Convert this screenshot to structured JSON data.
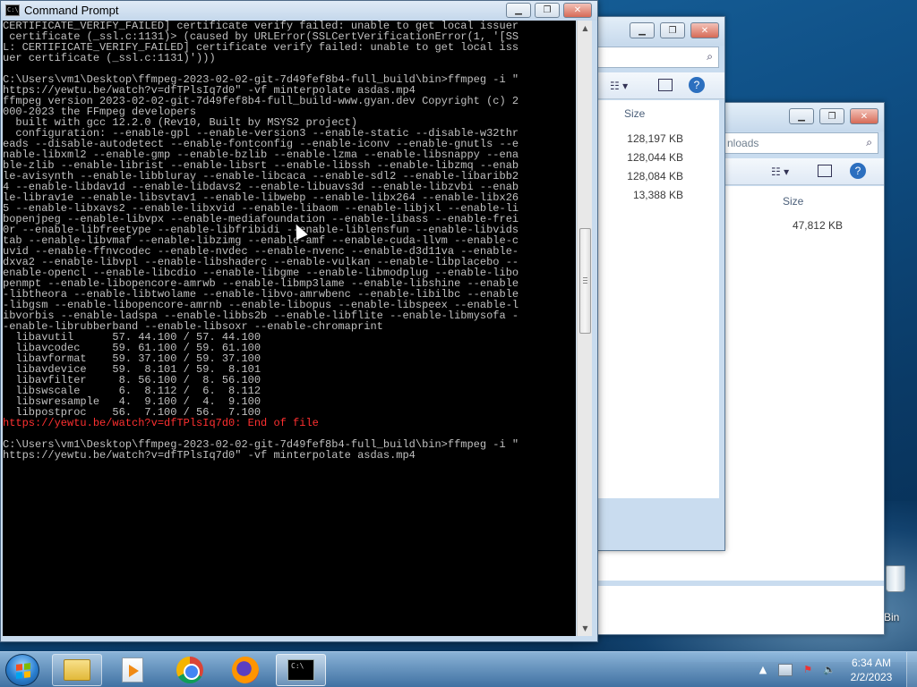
{
  "desktop": {
    "recycle_bin_label": "Bin"
  },
  "explorer_back": {
    "column_size": "Size",
    "sizes": [
      "128,197 KB",
      "128,044 KB",
      "128,084 KB",
      "13,388 KB"
    ]
  },
  "explorer_front": {
    "search_placeholder": "nloads",
    "column_size": "Size",
    "sizes": [
      "47,812 KB"
    ]
  },
  "cmd": {
    "title": "Command Prompt",
    "icon_text": "C:\\",
    "lines": [
      "CERTIFICATE_VERIFY_FAILED] certificate verify failed: unable to get local issuer",
      " certificate (_ssl.c:1131)> (caused by URLError(SSLCertVerificationError(1, '[SS",
      "L: CERTIFICATE_VERIFY_FAILED] certificate verify failed: unable to get local iss",
      "uer certificate (_ssl.c:1131)')))",
      "",
      "C:\\Users\\vm1\\Desktop\\ffmpeg-2023-02-02-git-7d49fef8b4-full_build\\bin>ffmpeg -i \"",
      "https://yewtu.be/watch?v=dfTPlsIq7d0\" -vf minterpolate asdas.mp4",
      "ffmpeg version 2023-02-02-git-7d49fef8b4-full_build-www.gyan.dev Copyright (c) 2",
      "000-2023 the FFmpeg developers",
      "  built with gcc 12.2.0 (Rev10, Built by MSYS2 project)",
      "  configuration: --enable-gpl --enable-version3 --enable-static --disable-w32thr",
      "eads --disable-autodetect --enable-fontconfig --enable-iconv --enable-gnutls --e",
      "nable-libxml2 --enable-gmp --enable-bzlib --enable-lzma --enable-libsnappy --ena",
      "ble-zlib --enable-librist --enable-libsrt --enable-libssh --enable-libzmq --enab",
      "le-avisynth --enable-libbluray --enable-libcaca --enable-sdl2 --enable-libaribb2",
      "4 --enable-libdav1d --enable-libdavs2 --enable-libuavs3d --enable-libzvbi --enab",
      "le-librav1e --enable-libsvtav1 --enable-libwebp --enable-libx264 --enable-libx26",
      "5 --enable-libxavs2 --enable-libxvid --enable-libaom --enable-libjxl --enable-li",
      "bopenjpeg --enable-libvpx --enable-mediafoundation --enable-libass --enable-frei",
      "0r --enable-libfreetype --enable-libfribidi --enable-liblensfun --enable-libvids",
      "tab --enable-libvmaf --enable-libzimg --enable-amf --enable-cuda-llvm --enable-c",
      "uvid --enable-ffnvcodec --enable-nvdec --enable-nvenc --enable-d3d11va --enable-",
      "dxva2 --enable-libvpl --enable-libshaderc --enable-vulkan --enable-libplacebo --",
      "enable-opencl --enable-libcdio --enable-libgme --enable-libmodplug --enable-libo",
      "penmpt --enable-libopencore-amrwb --enable-libmp3lame --enable-libshine --enable",
      "-libtheora --enable-libtwolame --enable-libvo-amrwbenc --enable-libilbc --enable",
      "-libgsm --enable-libopencore-amrnb --enable-libopus --enable-libspeex --enable-l",
      "ibvorbis --enable-ladspa --enable-libbs2b --enable-libflite --enable-libmysofa -",
      "-enable-librubberband --enable-libsoxr --enable-chromaprint",
      "  libavutil      57. 44.100 / 57. 44.100",
      "  libavcodec     59. 61.100 / 59. 61.100",
      "  libavformat    59. 37.100 / 59. 37.100",
      "  libavdevice    59.  8.101 / 59.  8.101",
      "  libavfilter     8. 56.100 /  8. 56.100",
      "  libswscale      6.  8.112 /  6.  8.112",
      "  libswresample   4.  9.100 /  4.  9.100",
      "  libpostproc    56.  7.100 / 56.  7.100",
      "https://yewtu.be/watch?v=dfTPlsIq7d0: End of file",
      "",
      "C:\\Users\\vm1\\Desktop\\ffmpeg-2023-02-02-git-7d49fef8b4-full_build\\bin>ffmpeg -i \"",
      "https://yewtu.be/watch?v=dfTPlsIq7d0\" -vf minterpolate asdas.mp4"
    ],
    "error_line_index": 37,
    "colors": {
      "background": "#000000",
      "text": "#c0c0c0",
      "error": "#ff3030"
    }
  },
  "taskbar": {
    "apps": [
      "file-explorer-icon",
      "media-player-icon",
      "chrome-icon",
      "firefox-icon",
      "command-prompt-icon"
    ],
    "clock_time": "6:34 AM",
    "clock_date": "2/2/2023",
    "tray_icons": [
      "show-hidden-icons-icon",
      "network-icon",
      "action-center-flag-icon",
      "volume-icon"
    ]
  }
}
